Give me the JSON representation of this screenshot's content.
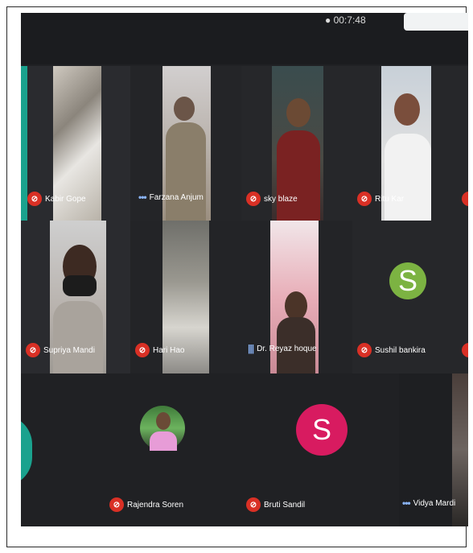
{
  "meeting": {
    "clock": "● 00:7:48"
  },
  "participants": [
    {
      "name": "Kabir Gope",
      "mic": "muted"
    },
    {
      "name": "Farzana Anjum",
      "mic": "dots"
    },
    {
      "name": "sky blaze",
      "mic": "muted"
    },
    {
      "name": "Ritu Kar",
      "mic": "muted"
    },
    {
      "name": "Supriya Mandi",
      "mic": "muted"
    },
    {
      "name": "Hari Hao",
      "mic": "muted"
    },
    {
      "name": "Dr. Reyaz hoque",
      "mic": "speaking"
    },
    {
      "name": "Sushil bankira",
      "mic": "muted",
      "avatar_letter": "S",
      "avatar_color": "#7cb342"
    },
    {
      "name": "Rajendra Soren",
      "mic": "muted"
    },
    {
      "name": "Bruti Sandil",
      "mic": "muted",
      "avatar_letter": "S",
      "avatar_color": "#d81b60"
    },
    {
      "name": "Vidya Mardi",
      "mic": "dots"
    }
  ],
  "icons": {
    "mic_off": "⊘",
    "dots": "•••",
    "speaking": "|||"
  }
}
